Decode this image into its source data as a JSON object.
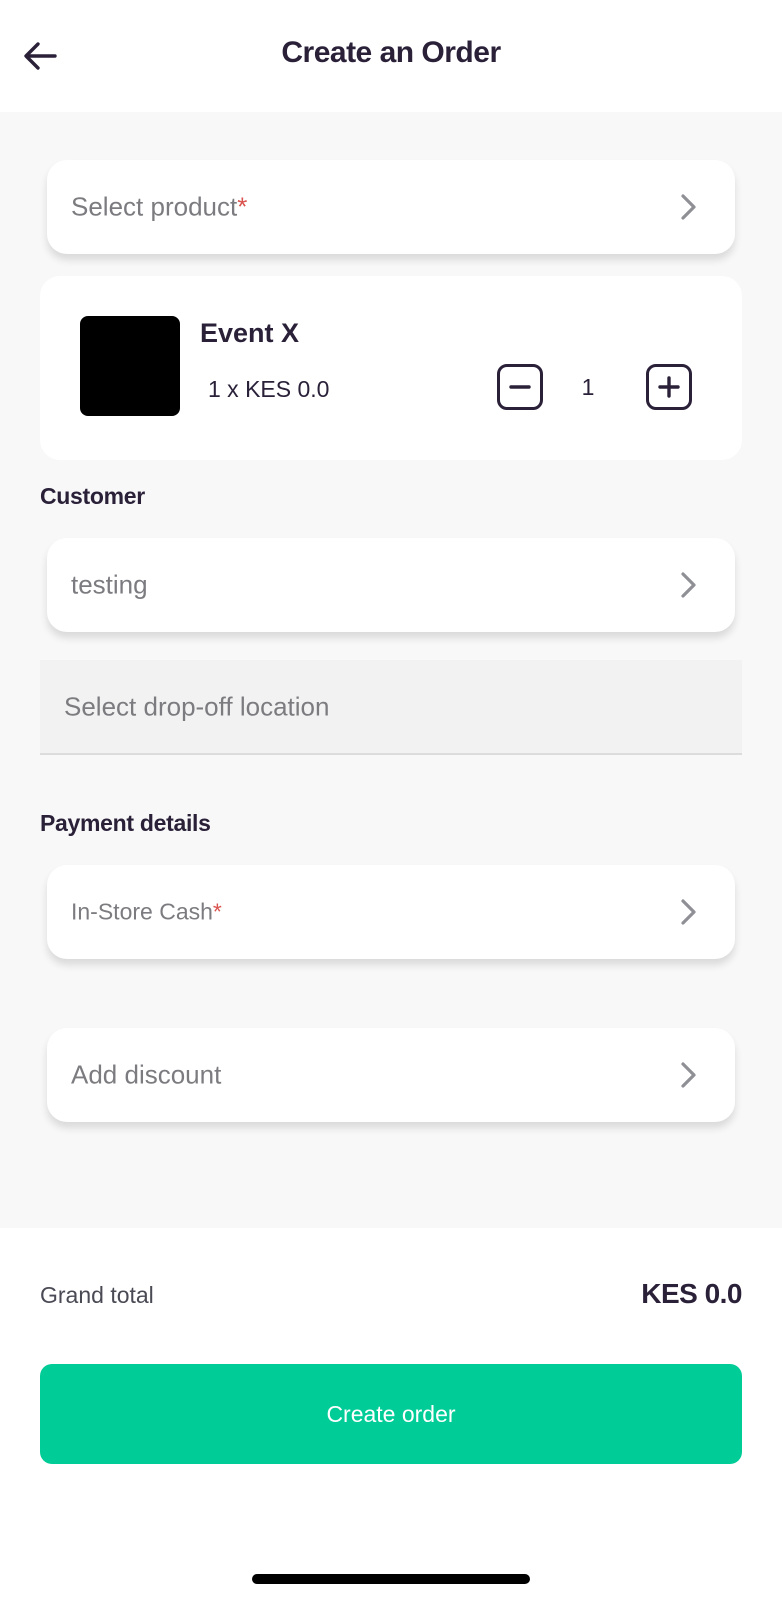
{
  "header": {
    "title": "Create an Order",
    "back_icon": "arrow-left-icon"
  },
  "product_select": {
    "placeholder": "Select product",
    "required_mark": "*"
  },
  "product_item": {
    "name": "Event X",
    "price_line": "1 x KES 0.0",
    "quantity": "1"
  },
  "customer": {
    "section_label": "Customer",
    "value": "testing"
  },
  "dropoff": {
    "placeholder": "Select drop-off location"
  },
  "payment": {
    "section_label": "Payment details",
    "method": "In-Store Cash",
    "required_mark": "*"
  },
  "discount": {
    "label": "Add discount"
  },
  "footer": {
    "total_label": "Grand total",
    "total_value": "KES 0.0",
    "create_button": "Create order"
  },
  "colors": {
    "accent": "#00cc98",
    "text_primary": "#2a2139",
    "required": "#d9534f"
  }
}
